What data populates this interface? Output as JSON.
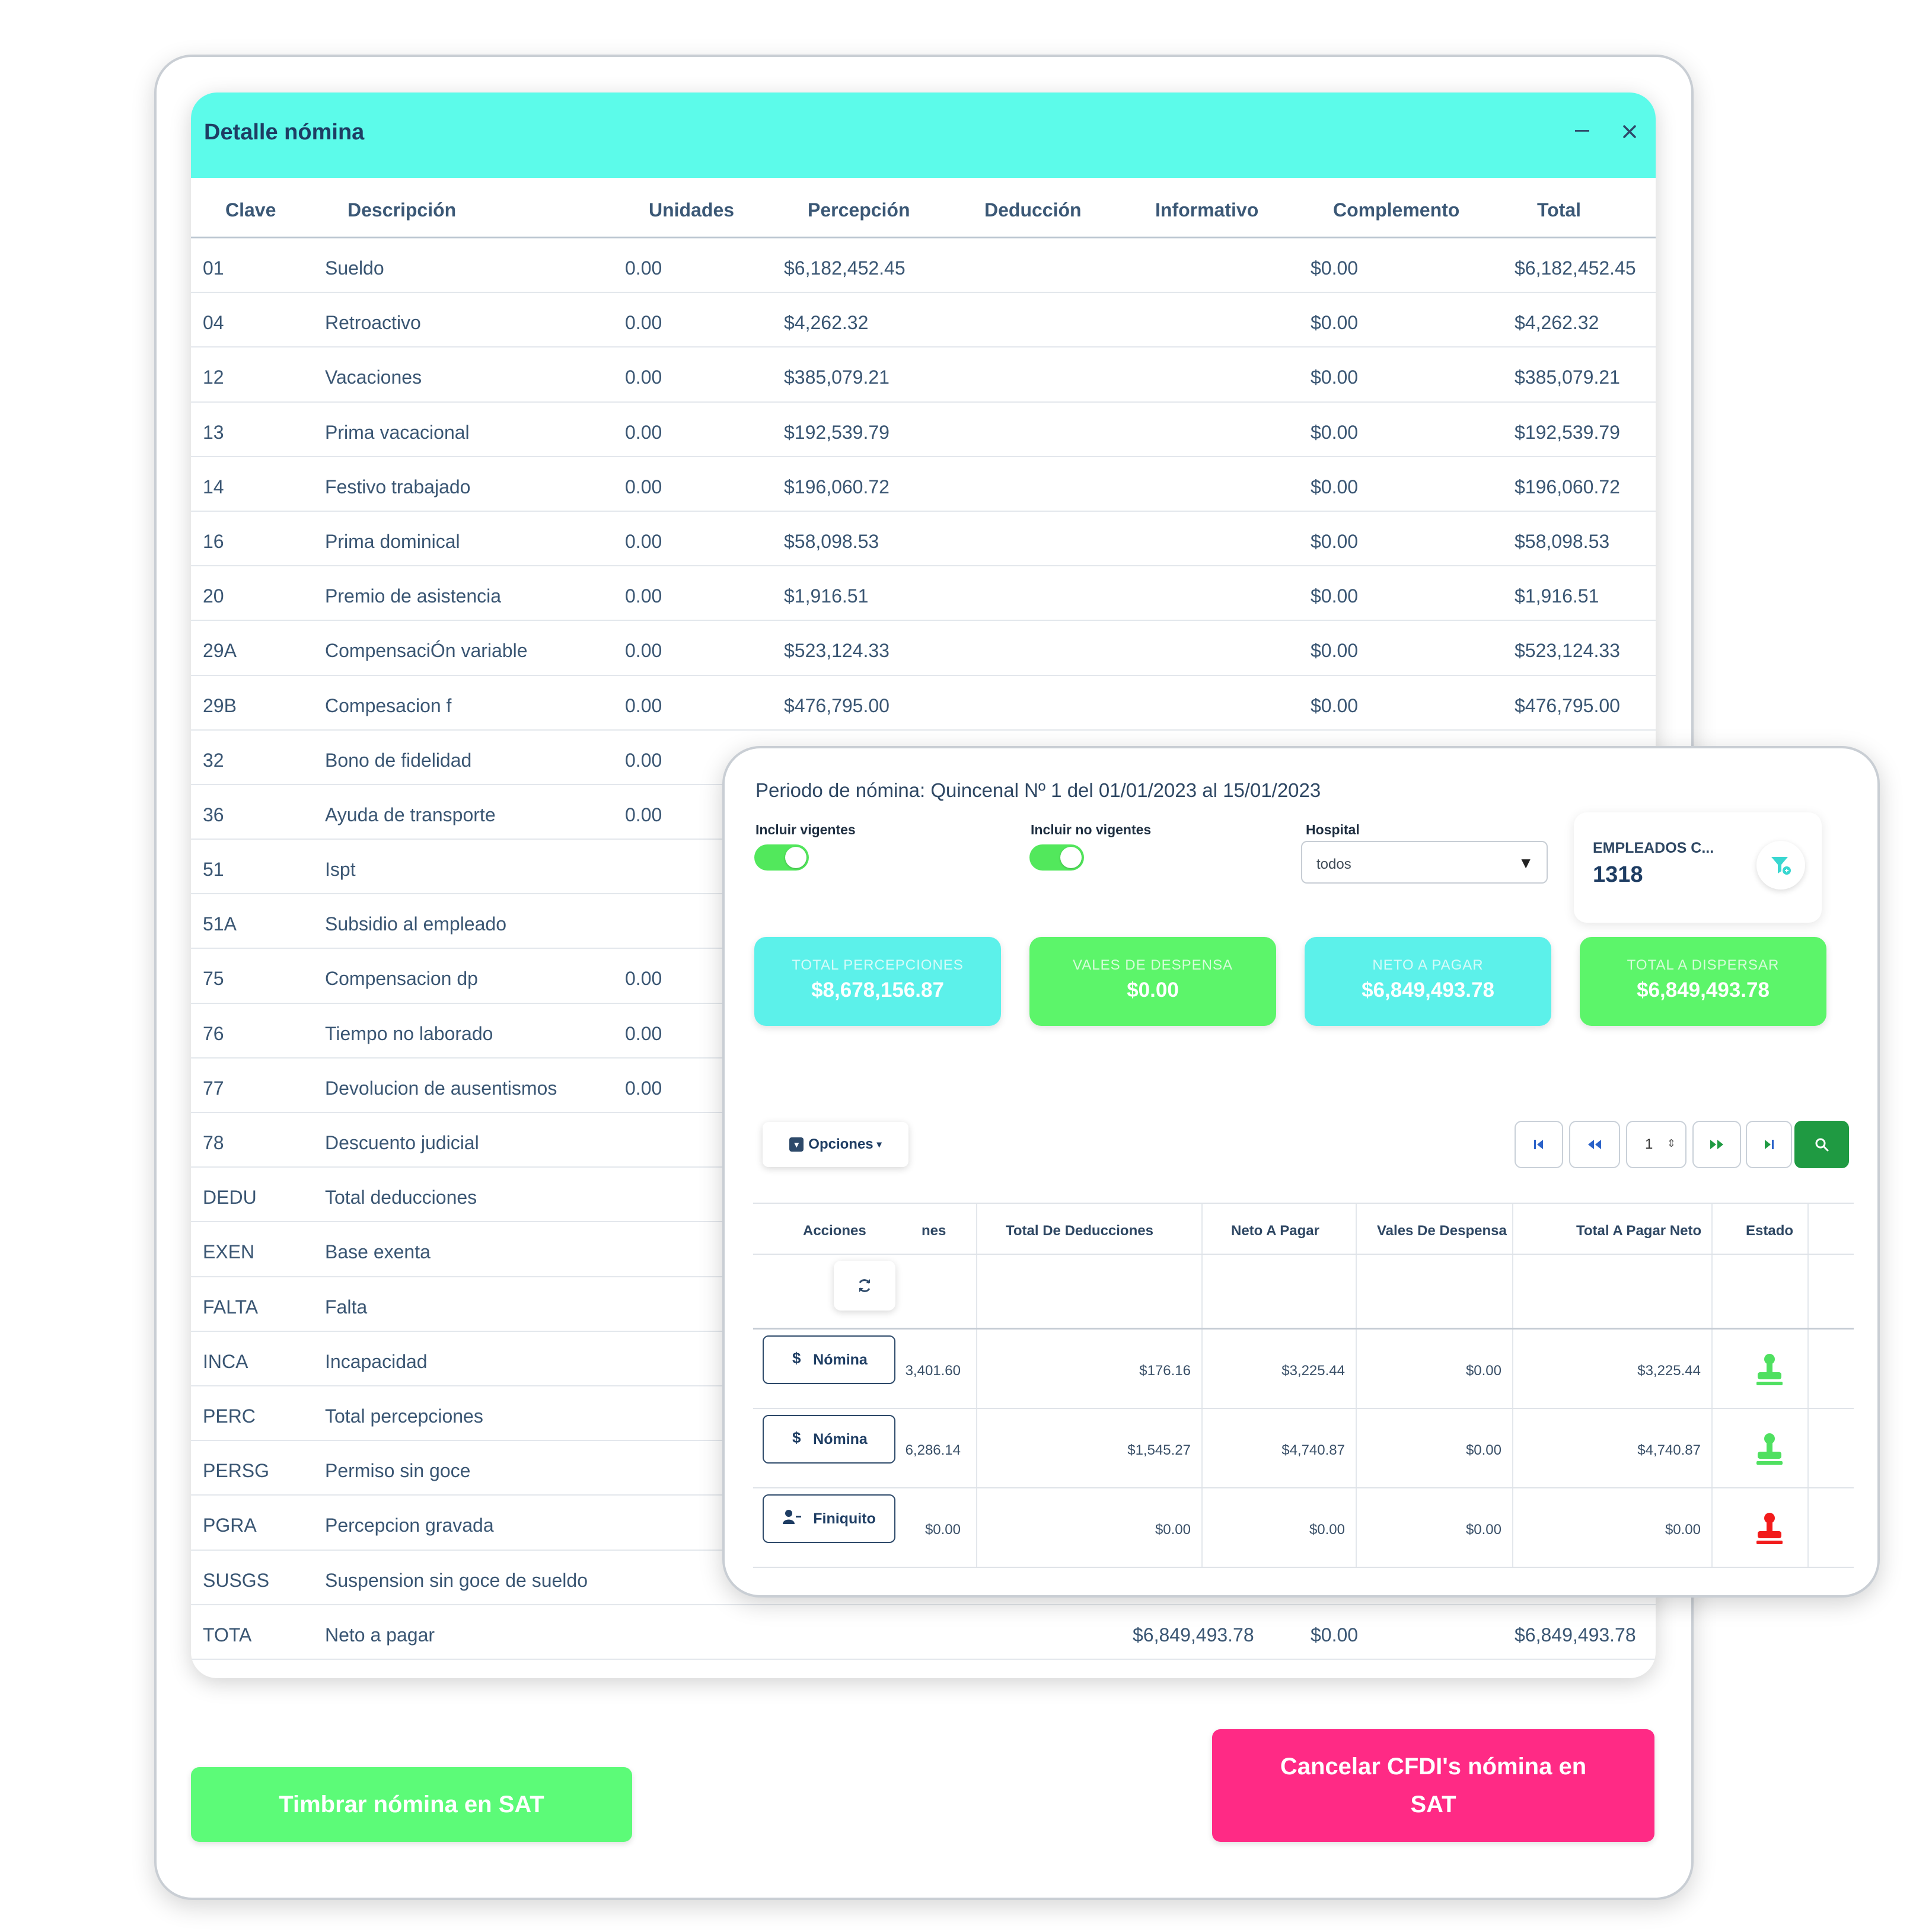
{
  "detalle": {
    "title": "Detalle nómina",
    "minimize_icon": "minimize-icon",
    "close_icon": "close-icon",
    "columns": [
      "Clave",
      "Descripción",
      "Unidades",
      "Percepción",
      "Deducción",
      "Informativo",
      "Complemento",
      "Total"
    ],
    "rows": [
      {
        "clave": "01",
        "desc": "Sueldo",
        "unid": "0.00",
        "perc": "$6,182,452.45",
        "ded": "",
        "comp": "$0.00",
        "total": "$6,182,452.45"
      },
      {
        "clave": "04",
        "desc": "Retroactivo",
        "unid": "0.00",
        "perc": "$4,262.32",
        "ded": "",
        "comp": "$0.00",
        "total": "$4,262.32"
      },
      {
        "clave": "12",
        "desc": "Vacaciones",
        "unid": "0.00",
        "perc": "$385,079.21",
        "ded": "",
        "comp": "$0.00",
        "total": "$385,079.21"
      },
      {
        "clave": "13",
        "desc": "Prima vacacional",
        "unid": "0.00",
        "perc": "$192,539.79",
        "ded": "",
        "comp": "$0.00",
        "total": "$192,539.79"
      },
      {
        "clave": "14",
        "desc": "Festivo trabajado",
        "unid": "0.00",
        "perc": "$196,060.72",
        "ded": "",
        "comp": "$0.00",
        "total": "$196,060.72"
      },
      {
        "clave": "16",
        "desc": "Prima dominical",
        "unid": "0.00",
        "perc": "$58,098.53",
        "ded": "",
        "comp": "$0.00",
        "total": "$58,098.53"
      },
      {
        "clave": "20",
        "desc": "Premio de asistencia",
        "unid": "0.00",
        "perc": "$1,916.51",
        "ded": "",
        "comp": "$0.00",
        "total": "$1,916.51"
      },
      {
        "clave": "29A",
        "desc": "CompensaciÓn variable",
        "unid": "0.00",
        "perc": "$523,124.33",
        "ded": "",
        "comp": "$0.00",
        "total": "$523,124.33"
      },
      {
        "clave": "29B",
        "desc": "Compesacion f",
        "unid": "0.00",
        "perc": "$476,795.00",
        "ded": "",
        "comp": "$0.00",
        "total": "$476,795.00"
      },
      {
        "clave": "32",
        "desc": "Bono de fidelidad",
        "unid": "0.00",
        "perc": "",
        "ded": "",
        "comp": "",
        "total": ""
      },
      {
        "clave": "36",
        "desc": "Ayuda de transporte",
        "unid": "0.00",
        "perc": "",
        "ded": "",
        "comp": "",
        "total": ""
      },
      {
        "clave": "51",
        "desc": "Ispt",
        "unid": "",
        "perc": "",
        "ded": "",
        "comp": "",
        "total": ""
      },
      {
        "clave": "51A",
        "desc": "Subsidio al empleado",
        "unid": "",
        "perc": "",
        "ded": "",
        "comp": "",
        "total": ""
      },
      {
        "clave": "75",
        "desc": "Compensacion dp",
        "unid": "0.00",
        "perc": "",
        "ded": "",
        "comp": "",
        "total": ""
      },
      {
        "clave": "76",
        "desc": "Tiempo no laborado",
        "unid": "0.00",
        "perc": "",
        "ded": "",
        "comp": "",
        "total": ""
      },
      {
        "clave": "77",
        "desc": "Devolucion de ausentismos",
        "unid": "0.00",
        "perc": "",
        "ded": "",
        "comp": "",
        "total": ""
      },
      {
        "clave": "78",
        "desc": "Descuento judicial",
        "unid": "",
        "perc": "",
        "ded": "",
        "comp": "",
        "total": ""
      },
      {
        "clave": "DEDU",
        "desc": "Total deducciones",
        "unid": "",
        "perc": "",
        "ded": "",
        "comp": "",
        "total": ""
      },
      {
        "clave": "EXEN",
        "desc": "Base exenta",
        "unid": "",
        "perc": "",
        "ded": "",
        "comp": "",
        "total": ""
      },
      {
        "clave": "FALTA",
        "desc": "Falta",
        "unid": "",
        "perc": "",
        "ded": "",
        "comp": "",
        "total": ""
      },
      {
        "clave": "INCA",
        "desc": "Incapacidad",
        "unid": "",
        "perc": "",
        "ded": "",
        "comp": "",
        "total": ""
      },
      {
        "clave": "PERC",
        "desc": "Total percepciones",
        "unid": "",
        "perc": "",
        "ded": "",
        "comp": "",
        "total": ""
      },
      {
        "clave": "PERSG",
        "desc": "Permiso sin goce",
        "unid": "",
        "perc": "",
        "ded": "",
        "comp": "",
        "total": ""
      },
      {
        "clave": "PGRA",
        "desc": "Percepcion gravada",
        "unid": "",
        "perc": "",
        "ded": "",
        "comp": "",
        "total": ""
      },
      {
        "clave": "SUSGS",
        "desc": "Suspension sin goce de sueldo",
        "unid": "",
        "perc": "",
        "ded": "",
        "comp": "",
        "total": ""
      },
      {
        "clave": "TOTA",
        "desc": "Neto a pagar",
        "unid": "",
        "perc": "",
        "ded": "$6,849,493.78",
        "comp": "$0.00",
        "total": "$6,849,493.78"
      }
    ]
  },
  "actions": {
    "timbrar_label": "Timbrar nómina en SAT",
    "cancelar_label": "Cancelar CFDI's nómina en SAT"
  },
  "periodo": {
    "title": "Periodo de nómina: Quincenal Nº 1 del 01/01/2023 al 15/01/2023",
    "incluir_vigentes_label": "Incluir vigentes",
    "incluir_no_vigentes_label": "Incluir no vigentes",
    "hospital_label": "Hospital",
    "hospital_value": "todos",
    "empleados_label": "EMPLEADOS C...",
    "empleados_count": "1318",
    "stats": [
      {
        "label": "TOTAL PERCEPCIONES",
        "value": "$8,678,156.87",
        "color": "#5cf1ea"
      },
      {
        "label": "VALES DE DESPENSA",
        "value": "$0.00",
        "color": "#5cf56a"
      },
      {
        "label": "NETO A PAGAR",
        "value": "$6,849,493.78",
        "color": "#5cf1ea"
      },
      {
        "label": "TOTAL A DISPERSAR",
        "value": "$6,849,493.78",
        "color": "#5cf56a"
      }
    ],
    "opciones_label": "Opciones",
    "page_number": "1",
    "table": {
      "columns": [
        "Acciones",
        "nes",
        "Total De Deducciones",
        "Neto A Pagar",
        "Vales De Despensa",
        "Total A Pagar Neto",
        "Estado"
      ],
      "rows": [
        {
          "action": "Nómina",
          "action_icon": "dollar-icon",
          "nes": "3,401.60",
          "ded": "$176.16",
          "neto": "$3,225.44",
          "vales": "$0.00",
          "total": "$3,225.44",
          "estado": "stamp-green"
        },
        {
          "action": "Nómina",
          "action_icon": "dollar-icon",
          "nes": "6,286.14",
          "ded": "$1,545.27",
          "neto": "$4,740.87",
          "vales": "$0.00",
          "total": "$4,740.87",
          "estado": "stamp-green"
        },
        {
          "action": "Finiquito",
          "action_icon": "user-minus-icon",
          "nes": "$0.00",
          "ded": "$0.00",
          "neto": "$0.00",
          "vales": "$0.00",
          "total": "$0.00",
          "estado": "stamp-red"
        }
      ]
    }
  },
  "colors": {
    "header_cyan": "#5cfbea",
    "green": "#5cfb78",
    "pink": "#ff2a85",
    "stamp_green": "#4fe060",
    "stamp_red": "#f21b1b",
    "search_green": "#1f9a42"
  }
}
